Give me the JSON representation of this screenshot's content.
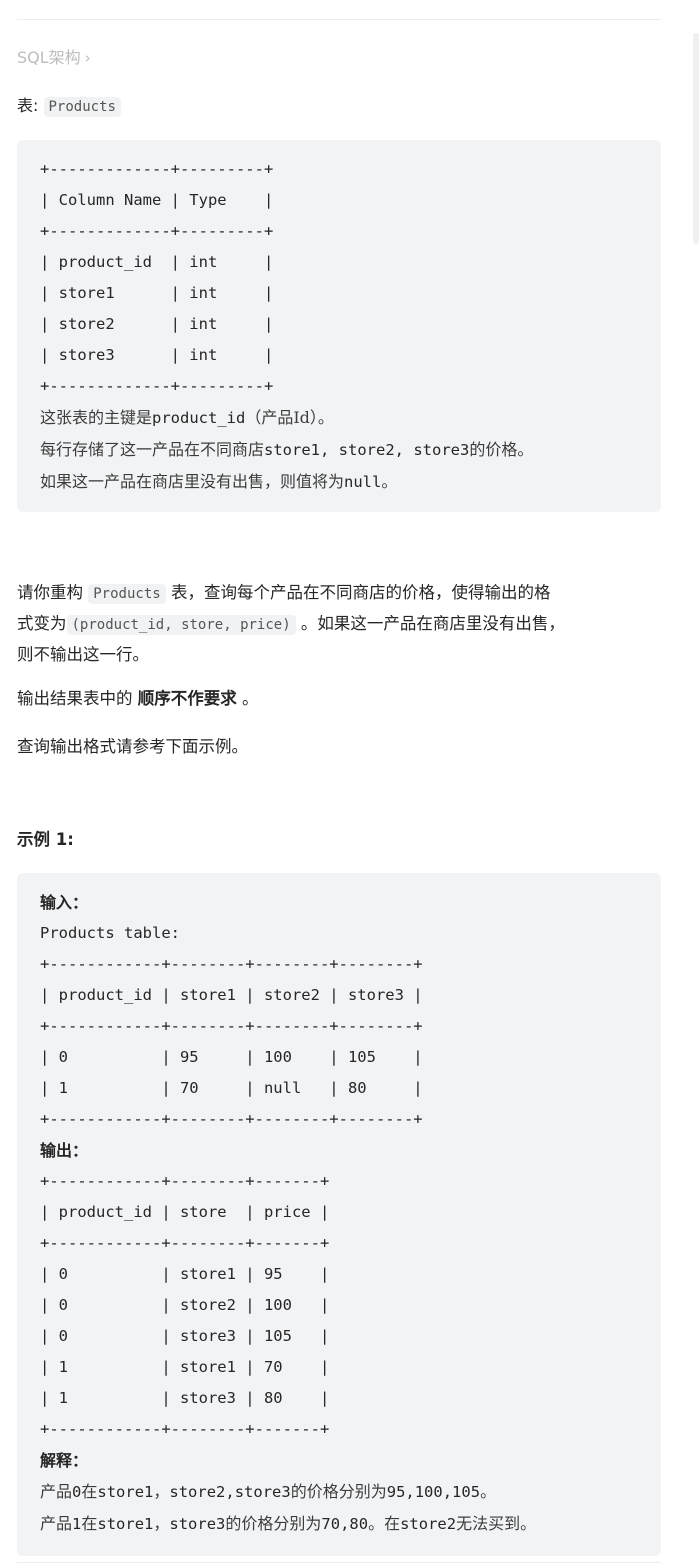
{
  "breadcrumb": {
    "label": "SQL架构",
    "chevron": "›"
  },
  "table_intro": {
    "prefix": "表:",
    "table_name": "Products"
  },
  "schema_block": {
    "ascii_table": "+-------------+---------+\n| Column Name | Type    |\n+-------------+---------+\n| product_id  | int     |\n| store1      | int     |\n| store2      | int     |\n| store3      | int     |\n+-------------+---------+",
    "note1_a": "这张表的主键是",
    "note1_code": "product_id",
    "note1_b": "（产品Id）。",
    "note2_a": "每行存储了这一产品在不同商店",
    "note2_code": "store1, store2, store3",
    "note2_b": "的价格。",
    "note3_a": "如果这一产品在商店里没有出售，则值将为",
    "note3_code": "null",
    "note3_b": "。"
  },
  "description": {
    "p1_a": "请你重构",
    "p1_code": "Products",
    "p1_b": "表，查询每个产品在不同商店的价格，使得输出的格",
    "p1_c": "式变为",
    "p1_code2": "(product_id, store, price)",
    "p1_d": "。如果这一产品在商店里没有出售，",
    "p1_e": "则不输出这一行。",
    "p2_a": "输出结果表中的",
    "p2_bold": "顺序不作要求",
    "p2_b": "。",
    "p3": "查询输出格式请参考下面示例。"
  },
  "example": {
    "title": "示例 1:",
    "input_label": "输入：",
    "input_table_label": "Products table:",
    "input_ascii": "+------------+--------+--------+--------+\n| product_id | store1 | store2 | store3 |\n+------------+--------+--------+--------+\n| 0          | 95     | 100    | 105    |\n| 1          | 70     | null   | 80     |\n+------------+--------+--------+--------+",
    "output_label": "输出：",
    "output_ascii": "+------------+--------+-------+\n| product_id | store  | price |\n+------------+--------+-------+\n| 0          | store1 | 95    |\n| 0          | store2 | 100   |\n| 0          | store3 | 105   |\n| 1          | store1 | 70    |\n| 1          | store3 | 80    |\n+------------+--------+-------+",
    "explain_label": "解释：",
    "explain1_a": "产品",
    "explain1_code1": "0",
    "explain1_b": "在",
    "explain1_code2": "store1",
    "explain1_c": "，",
    "explain1_code3": "store2,store3",
    "explain1_d": "的价格分别为",
    "explain1_code4": "95,100,105",
    "explain1_e": "。",
    "explain2_a": "产品",
    "explain2_code1": "1",
    "explain2_b": "在",
    "explain2_code2": "store1",
    "explain2_c": "，",
    "explain2_code3": "store3",
    "explain2_d": "的价格分别为",
    "explain2_code4": "70,80",
    "explain2_e": "。在",
    "explain2_code5": "store2",
    "explain2_f": "无法买到。"
  }
}
